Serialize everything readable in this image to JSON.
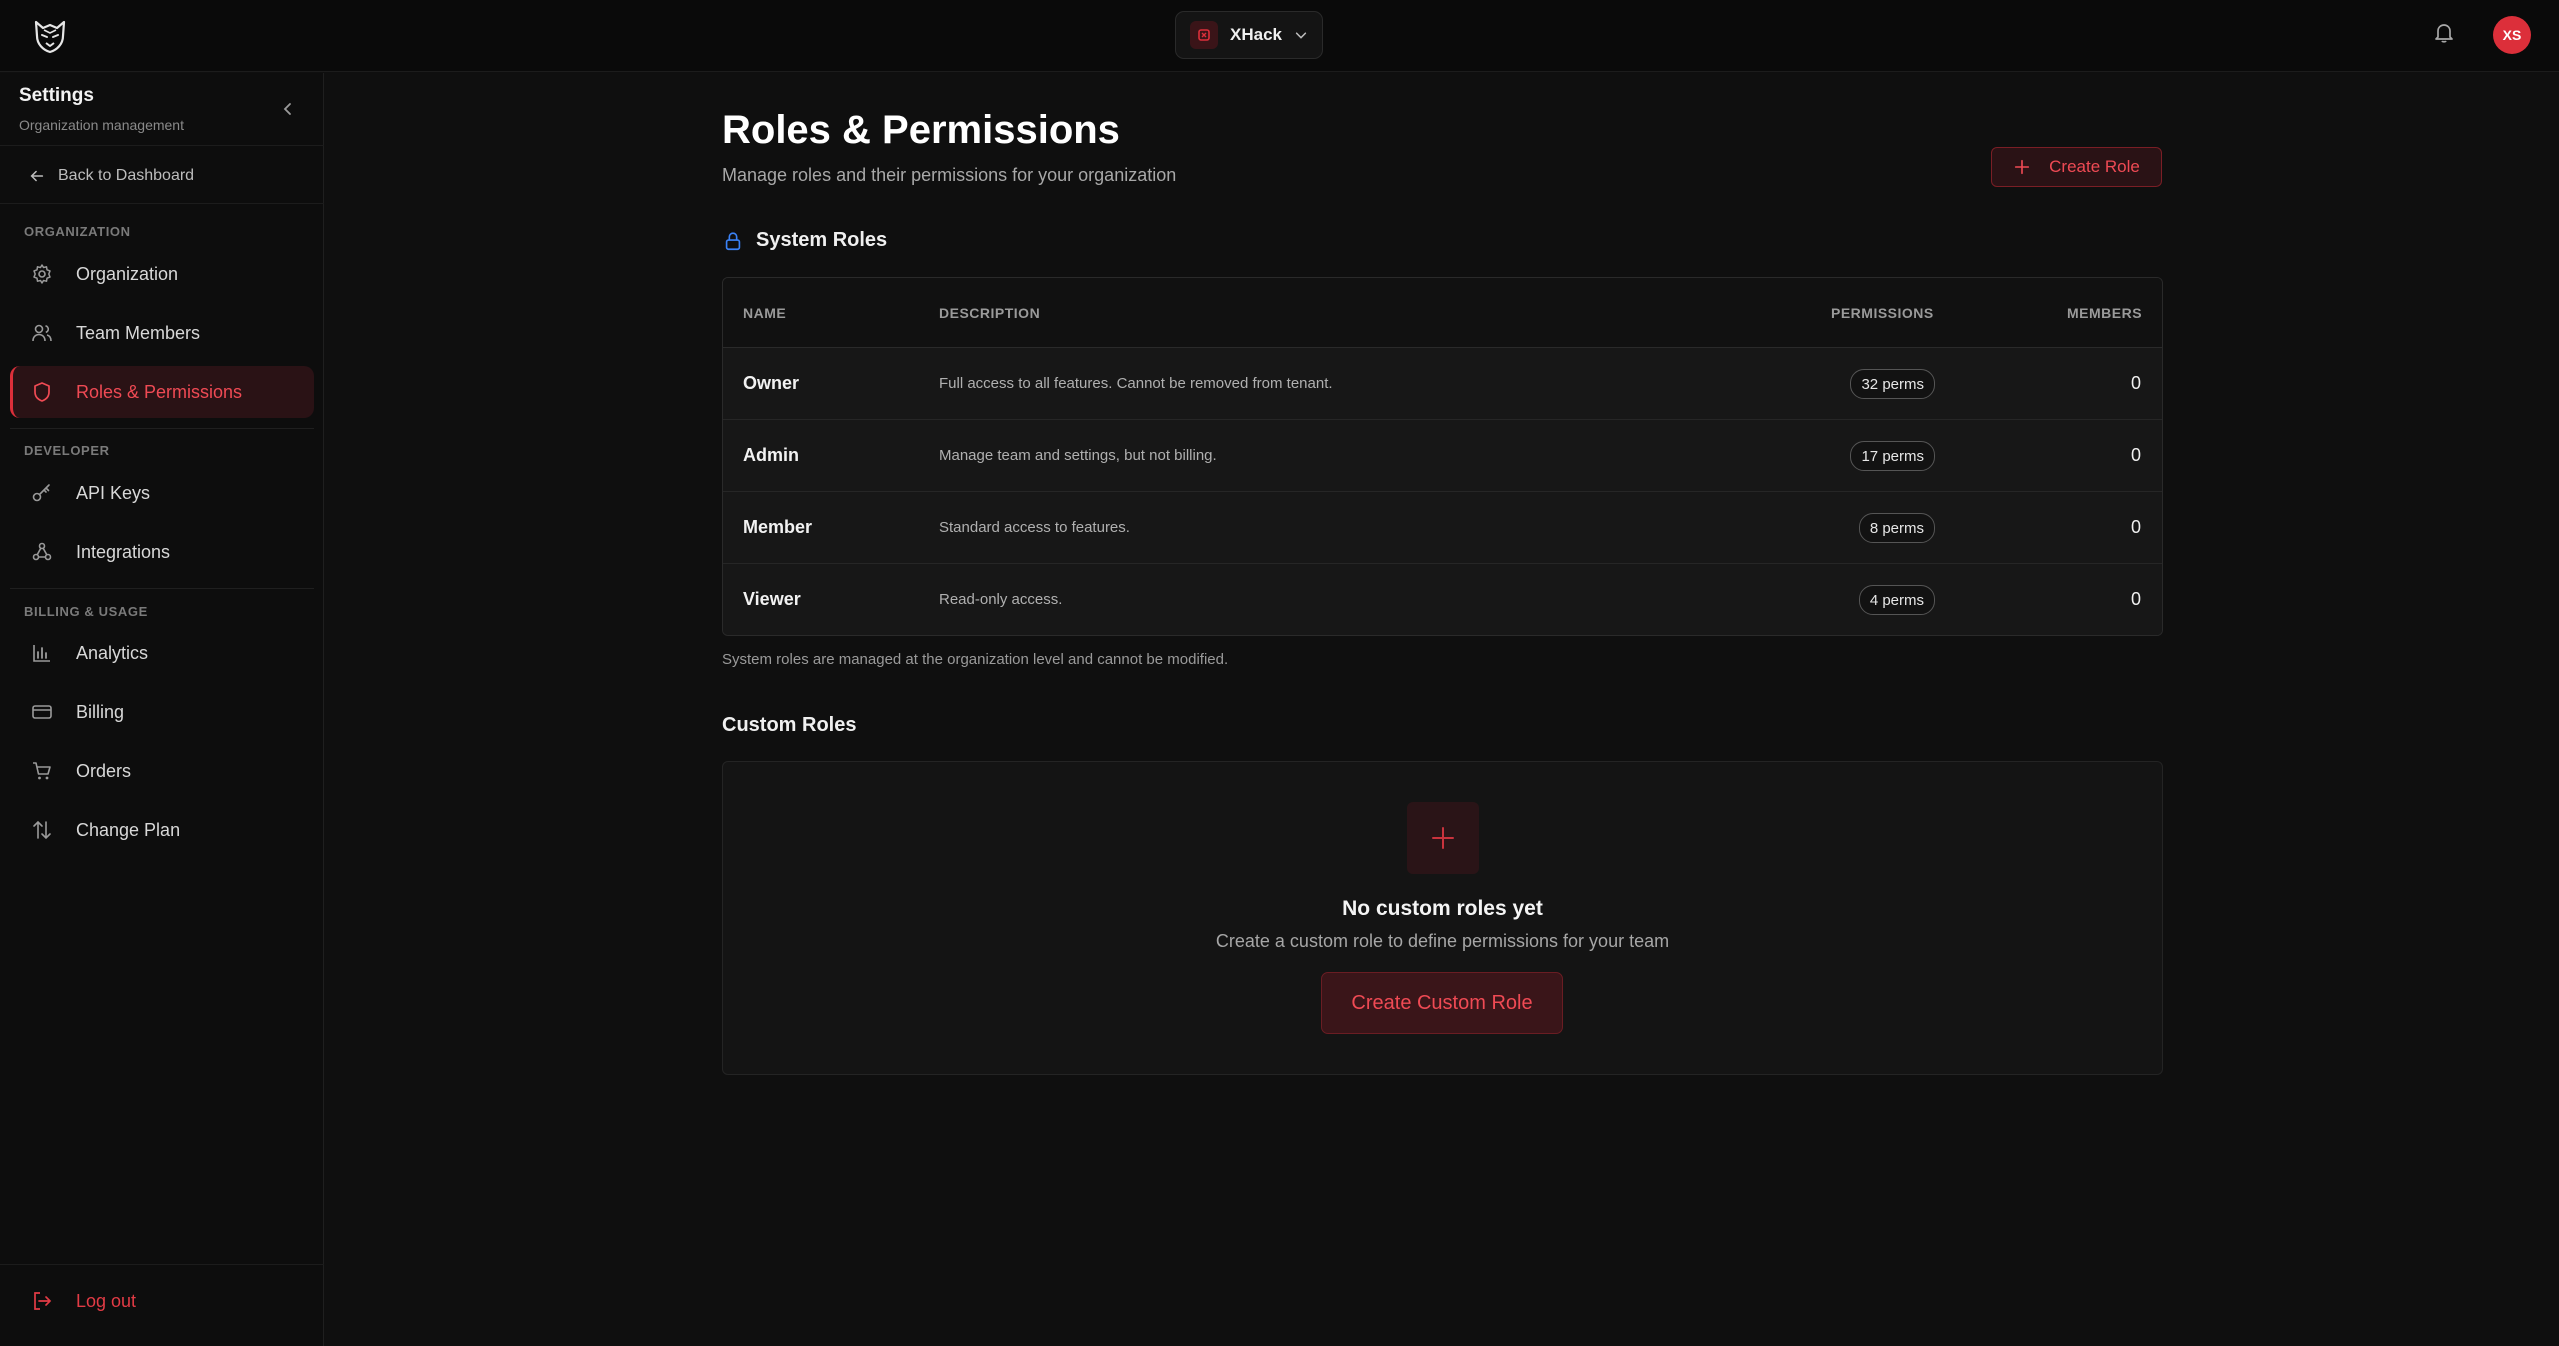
{
  "topbar": {
    "workspace_name": "XHack",
    "avatar_initials": "XS"
  },
  "sidebar": {
    "title": "Settings",
    "subtitle": "Organization management",
    "back_label": "Back to Dashboard",
    "sections": {
      "organization": "ORGANIZATION",
      "developer": "DEVELOPER",
      "billing": "BILLING & USAGE"
    },
    "items": {
      "organization": "Organization",
      "team_members": "Team Members",
      "roles": "Roles & Permissions",
      "api_keys": "API Keys",
      "integrations": "Integrations",
      "analytics": "Analytics",
      "billing": "Billing",
      "orders": "Orders",
      "change_plan": "Change Plan"
    },
    "logout_label": "Log out"
  },
  "main": {
    "title": "Roles & Permissions",
    "subtitle": "Manage roles and their permissions for your organization",
    "create_role_label": "Create Role",
    "system_roles": {
      "title": "System Roles",
      "headers": {
        "name": "NAME",
        "description": "DESCRIPTION",
        "permissions": "PERMISSIONS",
        "members": "MEMBERS"
      },
      "rows": [
        {
          "name": "Owner",
          "description": "Full access to all features. Cannot be removed from tenant.",
          "permissions": "32 perms",
          "members": "0"
        },
        {
          "name": "Admin",
          "description": "Manage team and settings, but not billing.",
          "permissions": "17 perms",
          "members": "0"
        },
        {
          "name": "Member",
          "description": "Standard access to features.",
          "permissions": "8 perms",
          "members": "0"
        },
        {
          "name": "Viewer",
          "description": "Read-only access.",
          "permissions": "4 perms",
          "members": "0"
        }
      ],
      "note": "System roles are managed at the organization level and cannot be modified."
    },
    "custom_roles": {
      "title": "Custom Roles",
      "empty_title": "No custom roles yet",
      "empty_subtitle": "Create a custom role to define permissions for your team",
      "cta_label": "Create Custom Role"
    }
  },
  "colors": {
    "accent": "#dc2f3a",
    "accent_text": "#ef4a54",
    "background": "#0f0f0f",
    "lock_icon": "#3b82f6"
  }
}
